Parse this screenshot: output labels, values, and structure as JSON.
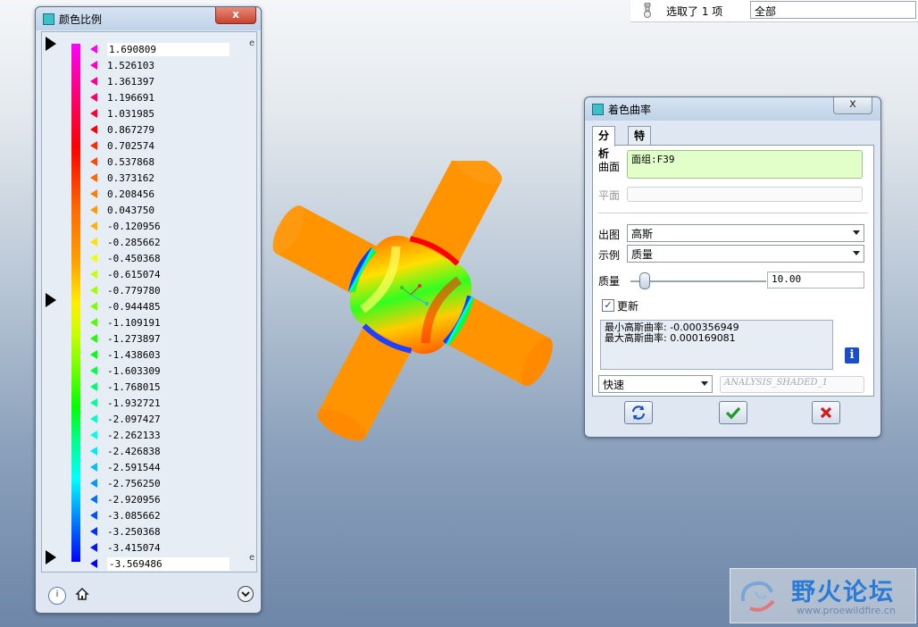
{
  "topbar": {
    "selection_text": "选取了 1 项",
    "filter_value": "全部"
  },
  "color_scale": {
    "title": "颜色比例",
    "close_label": "x",
    "exponent_label": "e",
    "values": [
      "1.690809",
      "1.526103",
      "1.361397",
      "1.196691",
      "1.031985",
      "0.867279",
      "0.702574",
      "0.537868",
      "0.373162",
      "0.208456",
      "0.043750",
      "-0.120956",
      "-0.285662",
      "-0.450368",
      "-0.615074",
      "-0.779780",
      "-0.944485",
      "-1.109191",
      "-1.273897",
      "-1.438603",
      "-1.603309",
      "-1.768015",
      "-1.932721",
      "-2.097427",
      "-2.262133",
      "-2.426838",
      "-2.591544",
      "-2.756250",
      "-2.920956",
      "-3.085662",
      "-3.250368",
      "-3.415074",
      "-3.569486"
    ],
    "tick_colors": [
      "#ff00ff",
      "#ff00c0",
      "#ff0090",
      "#ff0060",
      "#ff0030",
      "#ff0000",
      "#ff2a00",
      "#ff4800",
      "#ff6600",
      "#ff8000",
      "#ff9a00",
      "#ffb000",
      "#ffe000",
      "#f0ff00",
      "#c8ff00",
      "#a0ff00",
      "#7cff00",
      "#50ff00",
      "#20ff00",
      "#00ff10",
      "#00ff40",
      "#00ff70",
      "#00ffa0",
      "#00ffc8",
      "#00fff0",
      "#00e8ff",
      "#00c0ff",
      "#0098ff",
      "#0070ff",
      "#0050ff",
      "#0030ff",
      "#0018ff",
      "#0000ff"
    ]
  },
  "curvature": {
    "title": "着色曲率",
    "close_label": "x",
    "tabs": [
      "分析",
      "特征"
    ],
    "surface_label": "曲面",
    "surface_value": "面组:F39",
    "plane_label": "平面",
    "plot_label": "出图",
    "plot_value": "高斯",
    "show_label": "示例",
    "show_value": "质量",
    "quality_label": "质量",
    "quality_value": "10.00",
    "update_label": "更新",
    "update_checked": "✓",
    "result_min": "最小高斯曲率: -0.000356949",
    "result_max": "最大高斯曲率: 0.000169081",
    "mode_value": "快速",
    "feature_name_placeholder": "ANALYSIS_SHADED_1",
    "info_glyph": "i"
  },
  "watermark": {
    "name": "野火论坛",
    "url": "www.proewildfire.cn"
  }
}
